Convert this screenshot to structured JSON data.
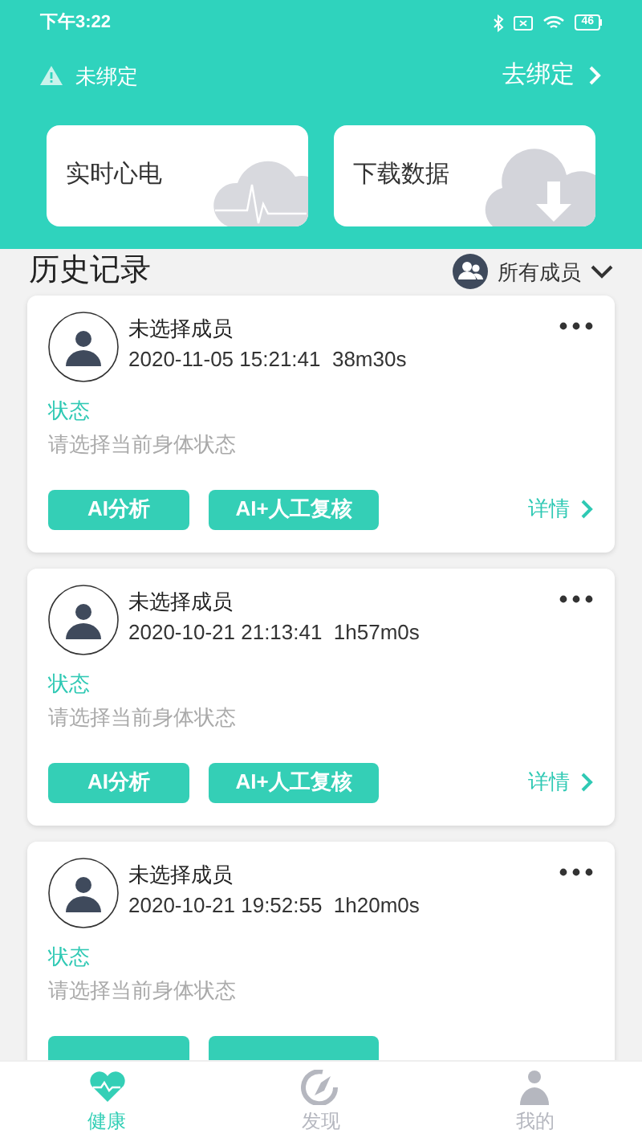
{
  "status_bar": {
    "time": "下午3:22",
    "battery": "46"
  },
  "binding": {
    "status": "未绑定",
    "action": "去绑定"
  },
  "shortcuts": [
    {
      "label": "实时心电",
      "kind": "ecg"
    },
    {
      "label": "下载数据",
      "kind": "download"
    }
  ],
  "history": {
    "title": "历史记录",
    "filter": "所有成员"
  },
  "records": [
    {
      "member": "未选择成员",
      "datetime": "2020-11-05 15:21:41",
      "duration": "38m30s",
      "status_label": "状态",
      "status_hint": "请选择当前身体状态",
      "buttons": [
        "AI分析",
        "AI+人工复核"
      ],
      "details": "详情"
    },
    {
      "member": "未选择成员",
      "datetime": "2020-10-21 21:13:41",
      "duration": "1h57m0s",
      "status_label": "状态",
      "status_hint": "请选择当前身体状态",
      "buttons": [
        "AI分析",
        "AI+人工复核"
      ],
      "details": "详情"
    },
    {
      "member": "未选择成员",
      "datetime": "2020-10-21 19:52:55",
      "duration": "1h20m0s",
      "status_label": "状态",
      "status_hint": "请选择当前身体状态",
      "cut_off": true
    }
  ],
  "tabs": [
    {
      "label": "健康",
      "kind": "health",
      "selected": true
    },
    {
      "label": "发现",
      "kind": "discover",
      "selected": false
    },
    {
      "label": "我的",
      "kind": "me",
      "selected": false
    }
  ]
}
